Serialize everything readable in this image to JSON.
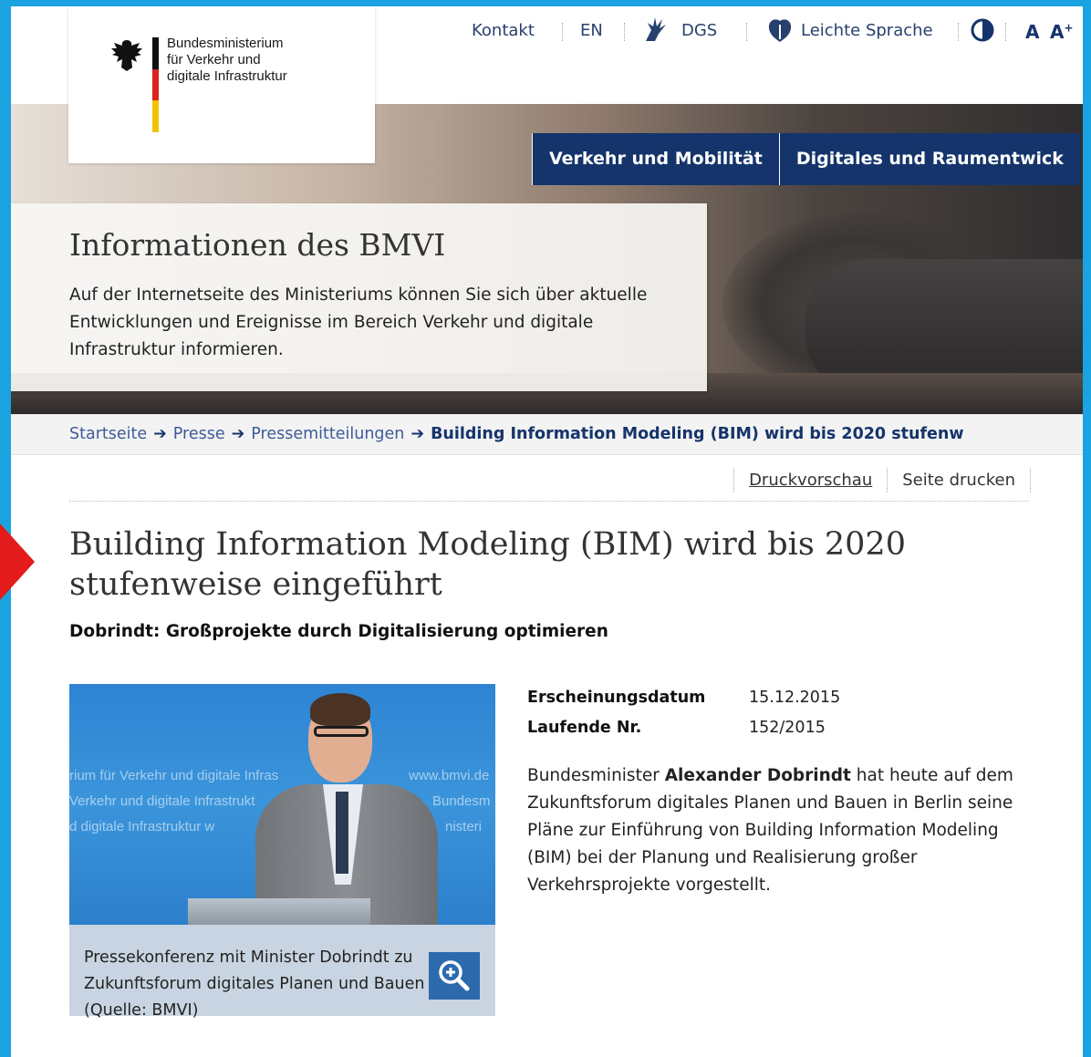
{
  "utility": {
    "contact": "Kontakt",
    "lang": "EN",
    "dgs": "DGS",
    "easy": "Leichte Sprache",
    "font_small": "A",
    "font_large": "A",
    "font_plus": "+"
  },
  "logo": {
    "line1": "Bundesministerium",
    "line2": "für Verkehr und",
    "line3": "digitale Infrastruktur"
  },
  "nav": {
    "items": [
      "Verkehr und Mobilität",
      "Digitales und Raumentwick"
    ]
  },
  "hero": {
    "title": "Informationen des BMVI",
    "text": "Auf der Internetseite des Ministeriums können Sie sich über aktuelle Entwicklungen und Ereignisse im Bereich Verkehr und digitale Infrastruktur informieren."
  },
  "breadcrumb": {
    "items": [
      "Startseite",
      "Presse",
      "Pressemitteilungen"
    ],
    "current": "Building Information Modeling (BIM) wird bis 2020 stufenw"
  },
  "tools": {
    "preview": "Druckvorschau",
    "print": "Seite drucken"
  },
  "article": {
    "title": "Building Information Modeling (BIM) wird bis 2020 stufenweise eingeführt",
    "subtitle": "Dobrindt: Großprojekte durch Digitalisierung optimieren",
    "meta": [
      {
        "label": "Erscheinungsdatum",
        "value": "15.12.2015"
      },
      {
        "label": "Laufende Nr.",
        "value": "152/2015"
      }
    ],
    "body_pre": "Bundesminister ",
    "body_bold": "Alexander Dobrindt",
    "body_post": " hat heute auf dem Zukunftsforum digitales Planen und Bauen in Berlin seine Pläne zur Einführung von Building Information Modeling (BIM) bei der Planung und Realisierung großer Verkehrsprojekte vorgestellt.",
    "caption": "Pressekonferenz mit Minister Dobrindt zu Zukunftsforum digitales Planen und Bauen (Quelle: BMVI)"
  },
  "photo_watermarks": {
    "line1": "rium für Verkehr und digitale Infras",
    "line2": "Verkehr und digitale Infrastrukt",
    "line3": "d digitale Infrastruktur   w",
    "url": "www.bmvi.de",
    "r2": "Bundesm",
    "r3": "nisteri"
  },
  "colors": {
    "frame": "#1aa3e0",
    "nav": "#15346b",
    "link": "#3d5a99",
    "pointer": "#e31b1b",
    "caption_bg": "#c8d4e1"
  }
}
